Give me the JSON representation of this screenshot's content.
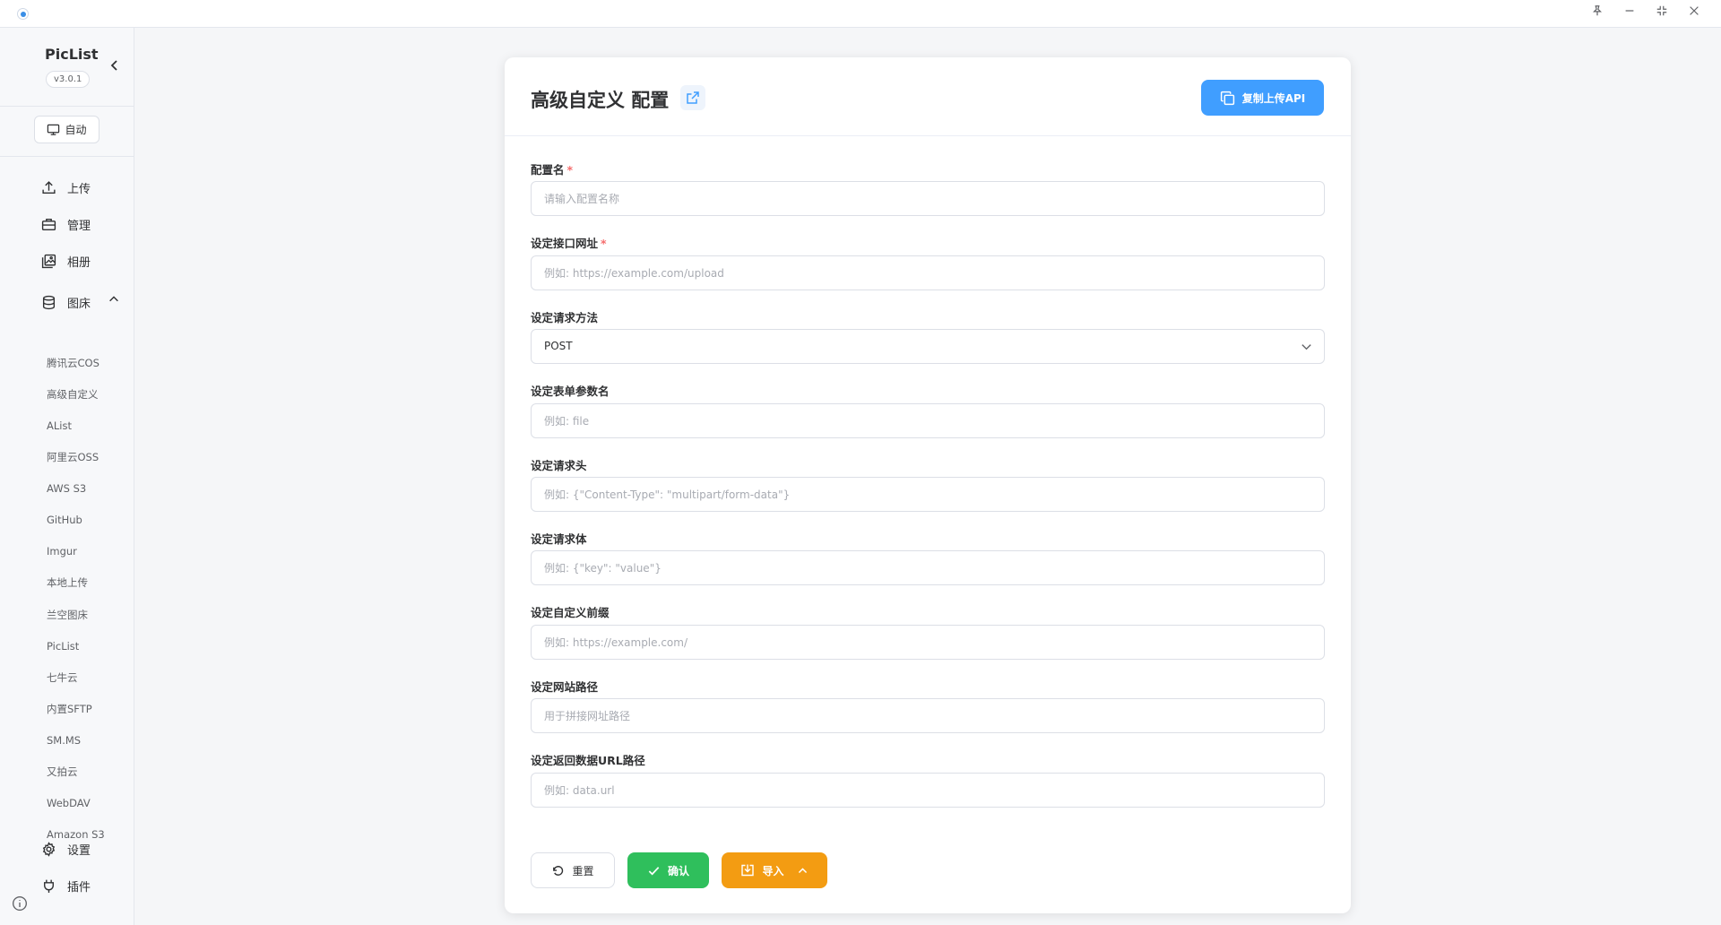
{
  "app": {
    "name": "PicList",
    "version": "v3.0.1",
    "theme_label": "自动"
  },
  "nav": {
    "upload": "上传",
    "manage": "管理",
    "album": "相册",
    "image_host": "图床",
    "settings": "设置",
    "plugins": "插件"
  },
  "image_hosts": [
    "腾讯云COS",
    "高级自定义",
    "AList",
    "阿里云OSS",
    "AWS S3",
    "GitHub",
    "Imgur",
    "本地上传",
    "兰空图床",
    "PicList",
    "七牛云",
    "内置SFTP",
    "SM.MS",
    "又拍云",
    "WebDAV",
    "Amazon S3"
  ],
  "page": {
    "title": "高级自定义 配置",
    "copy_api_label": "复制上传API"
  },
  "form": {
    "config_name": {
      "label": "配置名",
      "placeholder": "请输入配置名称"
    },
    "endpoint": {
      "label": "设定接口网址",
      "placeholder": "例如: https://example.com/upload"
    },
    "method": {
      "label": "设定请求方法",
      "value": "POST"
    },
    "form_field": {
      "label": "设定表单参数名",
      "placeholder": "例如: file"
    },
    "headers": {
      "label": "设定请求头",
      "placeholder": "例如: {\"Content-Type\": \"multipart/form-data\"}"
    },
    "body": {
      "label": "设定请求体",
      "placeholder": "例如: {\"key\": \"value\"}"
    },
    "prefix": {
      "label": "设定自定义前缀",
      "placeholder": "例如: https://example.com/"
    },
    "path": {
      "label": "设定网站路径",
      "placeholder": "用于拼接网址路径"
    },
    "url_path": {
      "label": "设定返回数据URL路径",
      "placeholder": "例如: data.url"
    }
  },
  "actions": {
    "reset": "重置",
    "confirm": "确认",
    "import": "导入"
  },
  "colors": {
    "primary": "#409eff",
    "success": "#2fbf5c",
    "warning": "#f39c12",
    "required": "#f56c6c"
  }
}
